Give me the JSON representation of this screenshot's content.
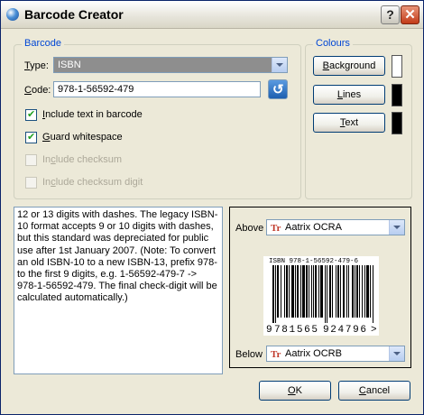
{
  "window": {
    "title": "Barcode Creator",
    "help_glyph": "?",
    "close_glyph": "✕"
  },
  "barcode_group": {
    "title": "Barcode",
    "type_label": "Type:",
    "type_value": "ISBN",
    "code_label": "Code:",
    "code_value": "978-1-56592-479",
    "include_text": {
      "label": "Include text in barcode",
      "checked": true,
      "enabled": true
    },
    "guard_whitespace": {
      "label": "Guard whitespace",
      "checked": true,
      "enabled": true
    },
    "include_checksum": {
      "label": "Include checksum",
      "checked": false,
      "enabled": false
    },
    "include_checksum_digit": {
      "label": "Include checksum digit",
      "checked": false,
      "enabled": false
    }
  },
  "colours_group": {
    "title": "Colours",
    "background_label": "Background",
    "background_color": "#ffffff",
    "lines_label": "Lines",
    "lines_color": "#000000",
    "text_label": "Text",
    "text_color": "#000000"
  },
  "description": "12 or 13 digits with dashes. The legacy ISBN-10 format accepts 9 or 10 digits with dashes, but this standard was depreciated for public use after 1st January 2007. (Note: To convert an old ISBN-10 to a new ISBN-13, prefix 978- to the first 9 digits, e.g. 1-56592-479-7 -> 978-1-56592-479. The final check-digit will be calculated automatically.)",
  "preview": {
    "above_label": "Above",
    "above_font": "Aatrix OCRA",
    "below_label": "Below",
    "below_font": "Aatrix OCRB",
    "font_icon_glyph": "Tr",
    "barcode_top_text": "ISBN 978-1-56592-479-6",
    "barcode_lead_digit": "9",
    "barcode_left_digits": "781565",
    "barcode_right_digits": "924796",
    "barcode_guard": ">"
  },
  "buttons": {
    "ok": "OK",
    "cancel": "Cancel"
  }
}
